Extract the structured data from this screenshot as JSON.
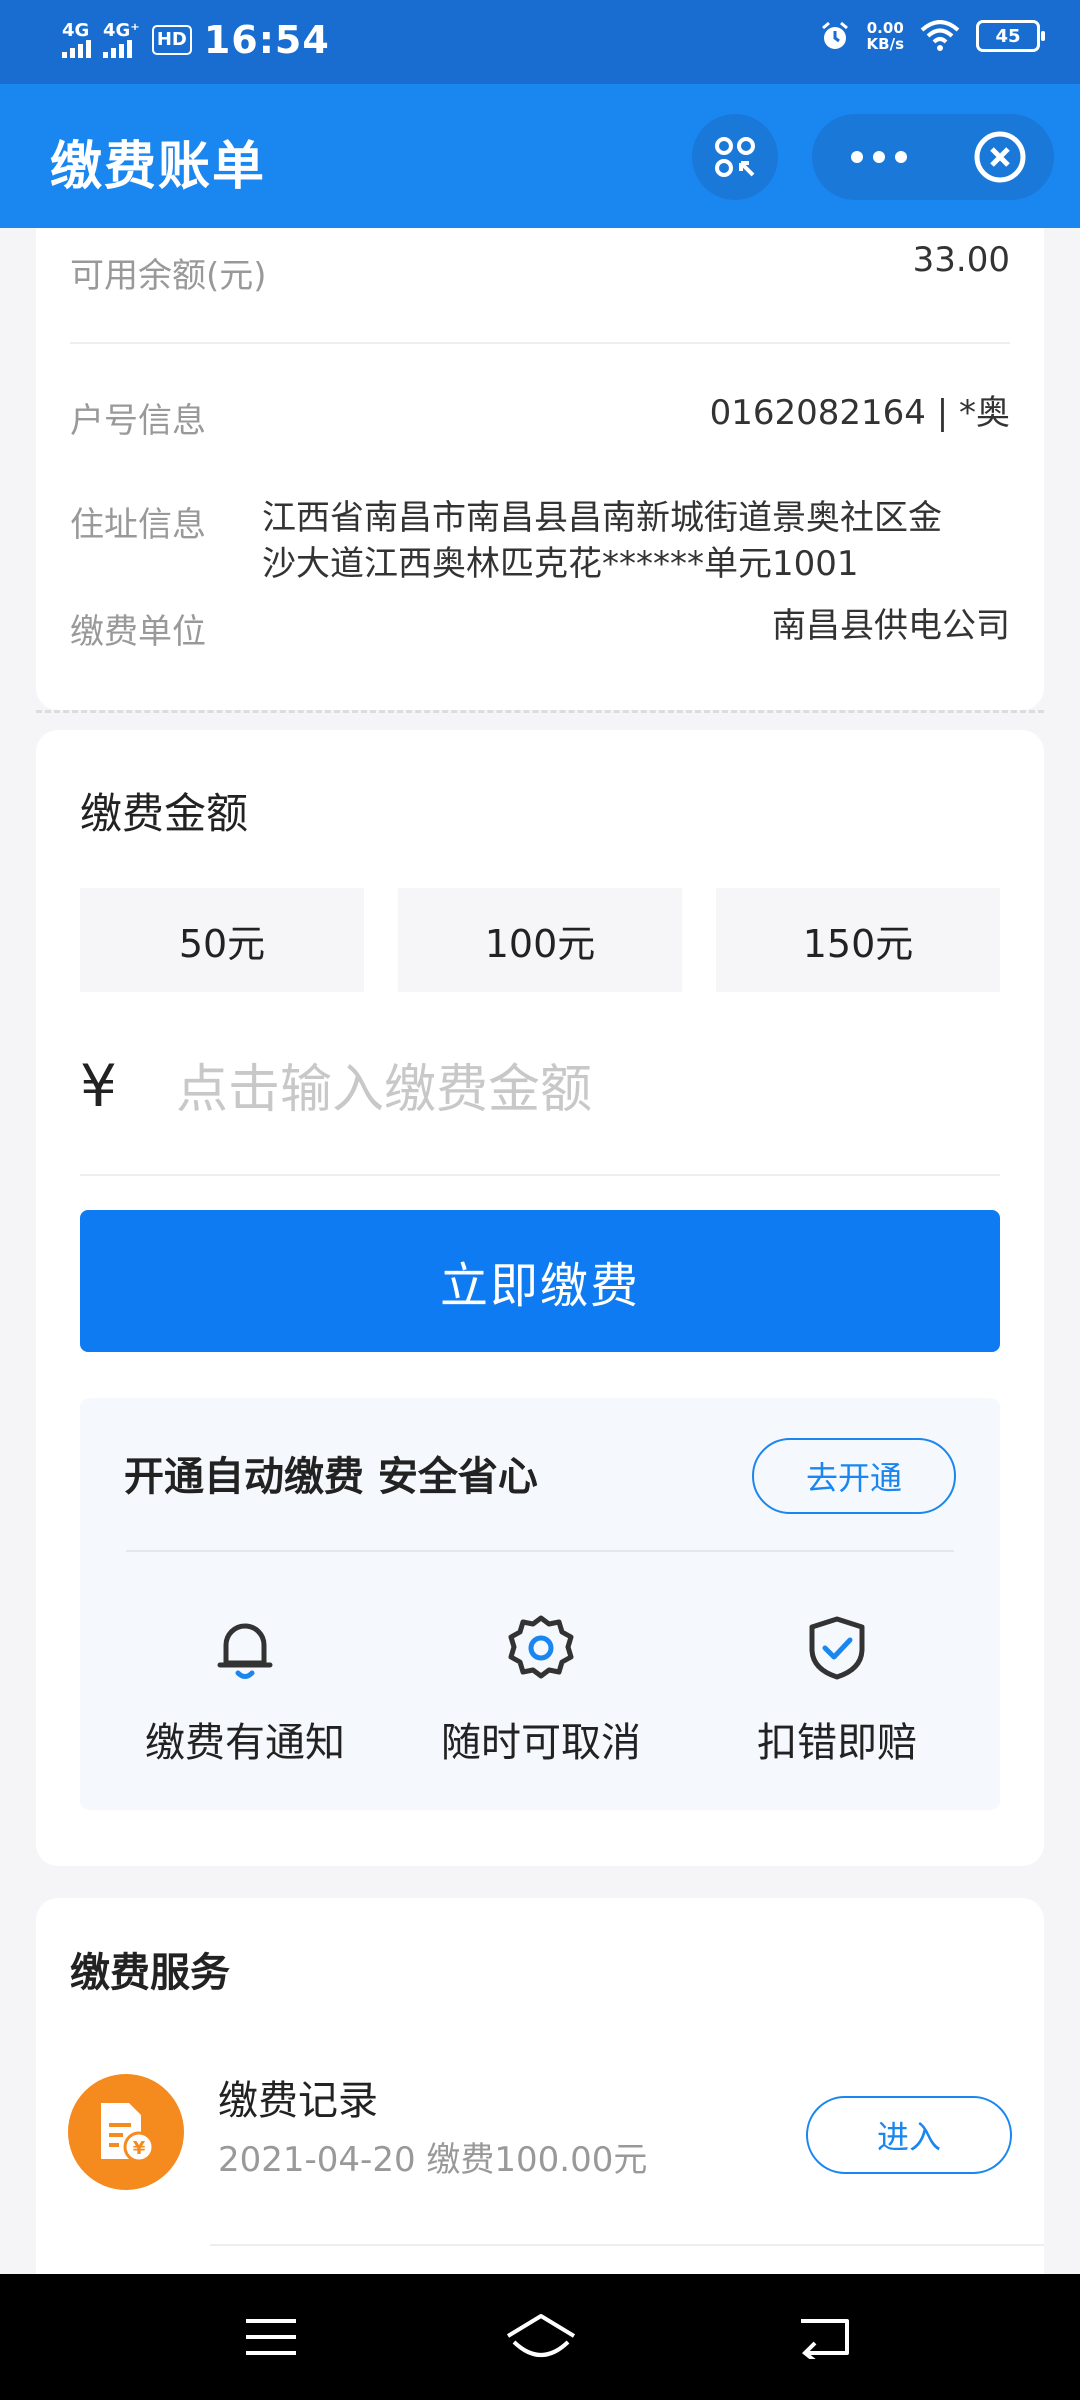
{
  "status_bar": {
    "network1": "4G",
    "network2": "4G⁺",
    "hd": "HD",
    "time": "16:54",
    "speed_value": "0.00",
    "speed_unit": "KB/s",
    "battery": "45",
    "icons": [
      "alarm-icon",
      "wifi-icon",
      "battery-icon"
    ]
  },
  "header": {
    "title": "缴费账单",
    "icons": [
      "scan-icon",
      "more-icon",
      "close-icon"
    ]
  },
  "account": {
    "balance_label": "可用余额(元)",
    "balance_value": "33.00",
    "account_label": "户号信息",
    "account_value": "0162082164 | *奥",
    "address_label": "住址信息",
    "address_line1": "江西省南昌市南昌县昌南新城街道景奥社区金",
    "address_line2": "沙大道江西奥林匹克花******单元1001",
    "unit_label": "缴费单位",
    "unit_value": "南昌县供电公司"
  },
  "payment": {
    "title": "缴费金额",
    "options": [
      "50元",
      "100元",
      "150元"
    ],
    "currency": "¥",
    "input_placeholder": "点击输入缴费金额",
    "pay_button": "立即缴费"
  },
  "autopay": {
    "title": "开通自动缴费 安全省心",
    "button": "去开通",
    "features": [
      {
        "label": "缴费有通知",
        "icon": "bell-icon"
      },
      {
        "label": "随时可取消",
        "icon": "gear-icon"
      },
      {
        "label": "扣错即赔",
        "icon": "shield-check-icon"
      }
    ]
  },
  "services": {
    "title": "缴费服务",
    "items": [
      {
        "name": "缴费记录",
        "detail": "2021-04-20 缴费100.00元",
        "button": "进入",
        "icon": "bill-icon"
      }
    ]
  },
  "colors": {
    "title_bar": "#1a86f0",
    "status_bar": "#1a6dd0",
    "primary_button": "#0f7bf2",
    "service_icon": "#f58a1f"
  }
}
